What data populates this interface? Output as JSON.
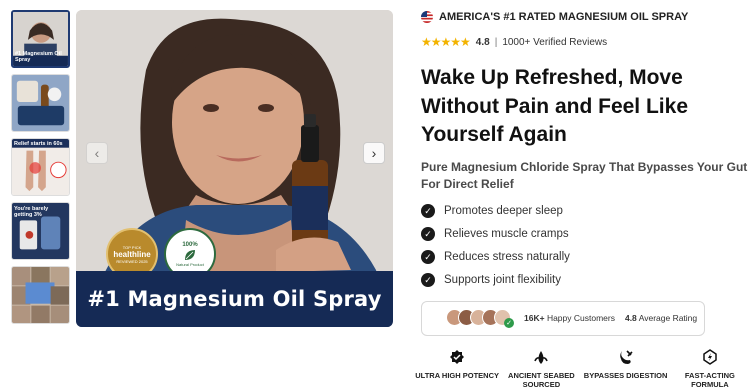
{
  "gallery": {
    "thumbnails": [
      {
        "caption": "#1 Magnesium Oil Spray"
      },
      {
        "caption": ""
      },
      {
        "caption": "Relief starts in 60s"
      },
      {
        "caption": "You're barely getting 3%"
      },
      {
        "caption": ""
      }
    ],
    "main_banner": "#1 Magnesium Oil Spray",
    "badges": {
      "healthline": {
        "top": "TOP PICK",
        "name": "healthline",
        "bottom": "REVIEWED 2025"
      },
      "natural": {
        "top": "100%",
        "bottom": "Natural Product"
      }
    },
    "prev_icon": "chevron-left-icon",
    "next_icon": "chevron-right-icon"
  },
  "product": {
    "tagline": "AMERICA'S #1 RATED MAGNESIUM OIL SPRAY",
    "rating": {
      "stars": "★★★★★",
      "value": "4.8",
      "separator": "|",
      "reviews": "1000+ Verified Reviews"
    },
    "headline": "Wake Up Refreshed, Move Without Pain and Feel Like Yourself Again",
    "subheadline": "Pure Magnesium Chloride Spray That Bypasses Your Gut For Direct Relief",
    "benefits": [
      "Promotes deeper sleep",
      "Relieves muscle cramps",
      "Reduces stress naturally",
      "Supports joint flexibility"
    ],
    "social_proof": {
      "count": "16K+",
      "count_label": "Happy Customers",
      "rating": "4.8",
      "rating_label": "Average Rating"
    },
    "features": [
      {
        "icon": "badge-check-icon",
        "label": "ULTRA HIGH POTENCY"
      },
      {
        "icon": "seaweed-icon",
        "label": "ANCIENT SEABED SOURCED"
      },
      {
        "icon": "stomach-bypass-icon",
        "label": "BYPASSES DIGESTION"
      },
      {
        "icon": "lightning-gear-icon",
        "label": "FAST-ACTING FORMULA"
      }
    ]
  },
  "colors": {
    "navy": "#152a55",
    "star": "#f3b300",
    "check": "#1a1a1a"
  }
}
